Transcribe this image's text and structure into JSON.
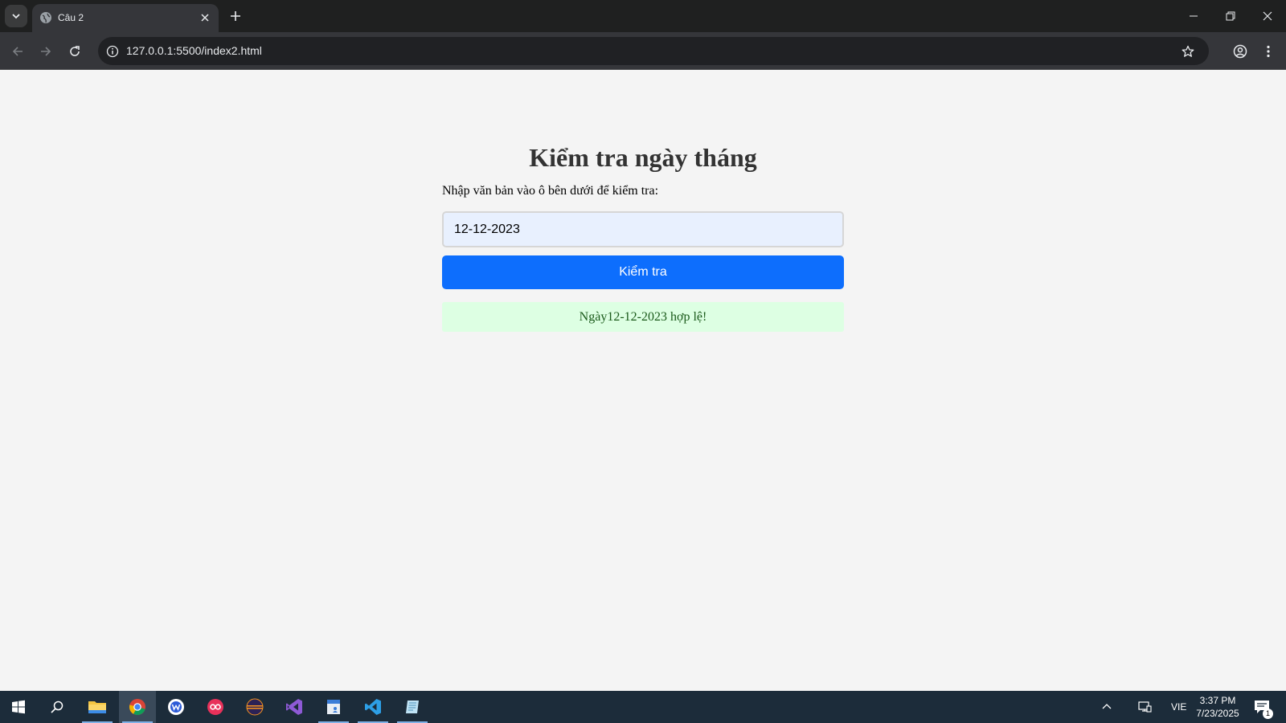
{
  "browser": {
    "tab": {
      "title": "Câu 2"
    },
    "address_bar": {
      "url": "127.0.0.1:5500/index2.html"
    }
  },
  "page": {
    "title": "Kiểm tra ngày tháng",
    "instruction": "Nhập văn bản vào ô bên dưới để kiểm tra:",
    "date_input": {
      "value": "12-12-2023"
    },
    "check_button": {
      "label": "Kiểm tra"
    },
    "result": {
      "text": "Ngày12-12-2023 hợp lệ!",
      "status_color": "#ddffe3"
    },
    "accent_color": "#0d6efd"
  },
  "taskbar": {
    "apps": [
      {
        "name": "file-explorer-icon"
      },
      {
        "name": "chrome-icon"
      },
      {
        "name": "app-w-icon"
      },
      {
        "name": "app-oo-icon"
      },
      {
        "name": "eclipse-icon"
      },
      {
        "name": "visual-studio-icon"
      },
      {
        "name": "notes-app-icon"
      },
      {
        "name": "vscode-icon"
      },
      {
        "name": "editor-app-icon"
      }
    ],
    "language": "VIE",
    "time": "3:37 PM",
    "date": "7/23/2025",
    "notification_count": "1"
  }
}
